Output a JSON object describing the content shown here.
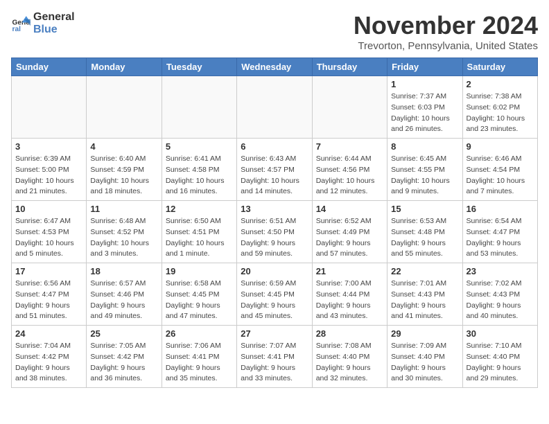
{
  "logo": {
    "line1": "General",
    "line2": "Blue"
  },
  "title": "November 2024",
  "location": "Trevorton, Pennsylvania, United States",
  "days_of_week": [
    "Sunday",
    "Monday",
    "Tuesday",
    "Wednesday",
    "Thursday",
    "Friday",
    "Saturday"
  ],
  "weeks": [
    [
      {
        "day": "",
        "info": ""
      },
      {
        "day": "",
        "info": ""
      },
      {
        "day": "",
        "info": ""
      },
      {
        "day": "",
        "info": ""
      },
      {
        "day": "",
        "info": ""
      },
      {
        "day": "1",
        "info": "Sunrise: 7:37 AM\nSunset: 6:03 PM\nDaylight: 10 hours and 26 minutes."
      },
      {
        "day": "2",
        "info": "Sunrise: 7:38 AM\nSunset: 6:02 PM\nDaylight: 10 hours and 23 minutes."
      }
    ],
    [
      {
        "day": "3",
        "info": "Sunrise: 6:39 AM\nSunset: 5:00 PM\nDaylight: 10 hours and 21 minutes."
      },
      {
        "day": "4",
        "info": "Sunrise: 6:40 AM\nSunset: 4:59 PM\nDaylight: 10 hours and 18 minutes."
      },
      {
        "day": "5",
        "info": "Sunrise: 6:41 AM\nSunset: 4:58 PM\nDaylight: 10 hours and 16 minutes."
      },
      {
        "day": "6",
        "info": "Sunrise: 6:43 AM\nSunset: 4:57 PM\nDaylight: 10 hours and 14 minutes."
      },
      {
        "day": "7",
        "info": "Sunrise: 6:44 AM\nSunset: 4:56 PM\nDaylight: 10 hours and 12 minutes."
      },
      {
        "day": "8",
        "info": "Sunrise: 6:45 AM\nSunset: 4:55 PM\nDaylight: 10 hours and 9 minutes."
      },
      {
        "day": "9",
        "info": "Sunrise: 6:46 AM\nSunset: 4:54 PM\nDaylight: 10 hours and 7 minutes."
      }
    ],
    [
      {
        "day": "10",
        "info": "Sunrise: 6:47 AM\nSunset: 4:53 PM\nDaylight: 10 hours and 5 minutes."
      },
      {
        "day": "11",
        "info": "Sunrise: 6:48 AM\nSunset: 4:52 PM\nDaylight: 10 hours and 3 minutes."
      },
      {
        "day": "12",
        "info": "Sunrise: 6:50 AM\nSunset: 4:51 PM\nDaylight: 10 hours and 1 minute."
      },
      {
        "day": "13",
        "info": "Sunrise: 6:51 AM\nSunset: 4:50 PM\nDaylight: 9 hours and 59 minutes."
      },
      {
        "day": "14",
        "info": "Sunrise: 6:52 AM\nSunset: 4:49 PM\nDaylight: 9 hours and 57 minutes."
      },
      {
        "day": "15",
        "info": "Sunrise: 6:53 AM\nSunset: 4:48 PM\nDaylight: 9 hours and 55 minutes."
      },
      {
        "day": "16",
        "info": "Sunrise: 6:54 AM\nSunset: 4:47 PM\nDaylight: 9 hours and 53 minutes."
      }
    ],
    [
      {
        "day": "17",
        "info": "Sunrise: 6:56 AM\nSunset: 4:47 PM\nDaylight: 9 hours and 51 minutes."
      },
      {
        "day": "18",
        "info": "Sunrise: 6:57 AM\nSunset: 4:46 PM\nDaylight: 9 hours and 49 minutes."
      },
      {
        "day": "19",
        "info": "Sunrise: 6:58 AM\nSunset: 4:45 PM\nDaylight: 9 hours and 47 minutes."
      },
      {
        "day": "20",
        "info": "Sunrise: 6:59 AM\nSunset: 4:45 PM\nDaylight: 9 hours and 45 minutes."
      },
      {
        "day": "21",
        "info": "Sunrise: 7:00 AM\nSunset: 4:44 PM\nDaylight: 9 hours and 43 minutes."
      },
      {
        "day": "22",
        "info": "Sunrise: 7:01 AM\nSunset: 4:43 PM\nDaylight: 9 hours and 41 minutes."
      },
      {
        "day": "23",
        "info": "Sunrise: 7:02 AM\nSunset: 4:43 PM\nDaylight: 9 hours and 40 minutes."
      }
    ],
    [
      {
        "day": "24",
        "info": "Sunrise: 7:04 AM\nSunset: 4:42 PM\nDaylight: 9 hours and 38 minutes."
      },
      {
        "day": "25",
        "info": "Sunrise: 7:05 AM\nSunset: 4:42 PM\nDaylight: 9 hours and 36 minutes."
      },
      {
        "day": "26",
        "info": "Sunrise: 7:06 AM\nSunset: 4:41 PM\nDaylight: 9 hours and 35 minutes."
      },
      {
        "day": "27",
        "info": "Sunrise: 7:07 AM\nSunset: 4:41 PM\nDaylight: 9 hours and 33 minutes."
      },
      {
        "day": "28",
        "info": "Sunrise: 7:08 AM\nSunset: 4:40 PM\nDaylight: 9 hours and 32 minutes."
      },
      {
        "day": "29",
        "info": "Sunrise: 7:09 AM\nSunset: 4:40 PM\nDaylight: 9 hours and 30 minutes."
      },
      {
        "day": "30",
        "info": "Sunrise: 7:10 AM\nSunset: 4:40 PM\nDaylight: 9 hours and 29 minutes."
      }
    ]
  ]
}
